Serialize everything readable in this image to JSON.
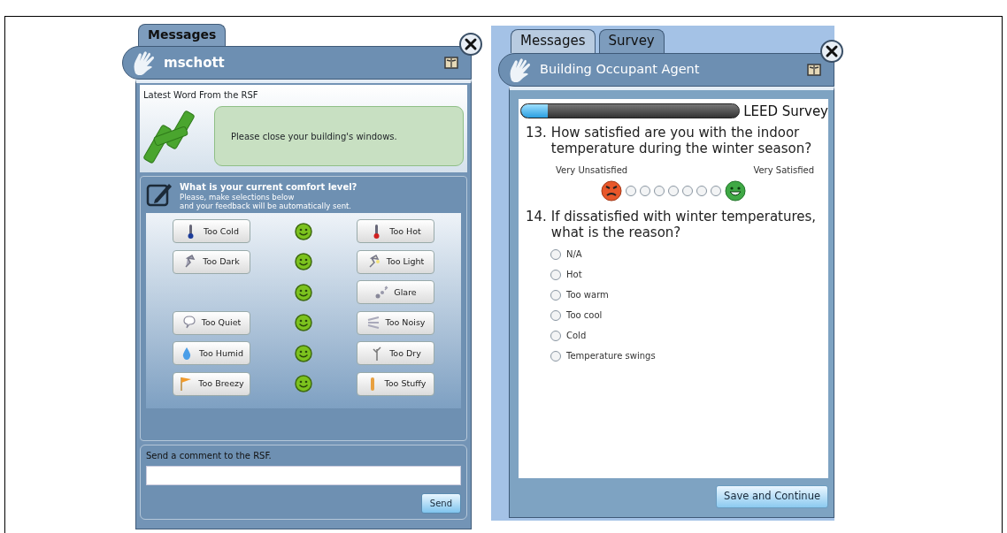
{
  "left_window": {
    "tabs": [
      {
        "label": "Messages",
        "selected": true
      }
    ],
    "user": "mschott",
    "section_title": "Latest Word From the RSF",
    "message": "Please close your building's windows.",
    "comfort": {
      "title": "What is your current comfort level?",
      "subtitle_lines": [
        "Please, make selections below",
        "and your feedback will be automatically sent."
      ],
      "rows": [
        {
          "left": "Too Cold",
          "right": "Too Hot"
        },
        {
          "left": "Too Dark",
          "right": "Too Light"
        },
        {
          "right": "Glare"
        },
        {
          "left": "Too Quiet",
          "right": "Too Noisy"
        },
        {
          "left": "Too Humid",
          "right": "Too Dry"
        },
        {
          "left": "Too Breezy",
          "right": "Too Stuffy"
        }
      ]
    },
    "comment": {
      "label": "Send a comment to the RSF.",
      "button": "Send"
    }
  },
  "right_window": {
    "tabs": [
      {
        "label": "Messages",
        "selected": false
      },
      {
        "label": "Survey",
        "selected": true
      }
    ],
    "agent": "Building Occupant Agent",
    "progress": {
      "level": 0.12,
      "label": "LEED Survey"
    },
    "questions": [
      {
        "kind": "scale",
        "number": "13.",
        "text": "How satisfied are you with the indoor temperature during the winter season?",
        "low_label": "Very Unsatisfied",
        "high_label": "Very Satisfied",
        "points": [
          {
            "selected": false
          },
          {
            "selected": false
          },
          {
            "selected": false
          },
          {
            "selected": false
          },
          {
            "selected": false
          },
          {
            "selected": false
          },
          {
            "selected": false
          }
        ]
      },
      {
        "kind": "choice",
        "number": "14.",
        "text": "If dissatisfied with winter temperatures, what is the reason?",
        "options": [
          {
            "label": "N/A",
            "selected": false
          },
          {
            "label": "Hot",
            "selected": false
          },
          {
            "label": "Too warm",
            "selected": false
          },
          {
            "label": "Too cool",
            "selected": false
          },
          {
            "label": "Cold",
            "selected": false
          },
          {
            "label": "Temperature swings",
            "selected": false
          }
        ]
      }
    ],
    "button": "Save and Continue"
  }
}
